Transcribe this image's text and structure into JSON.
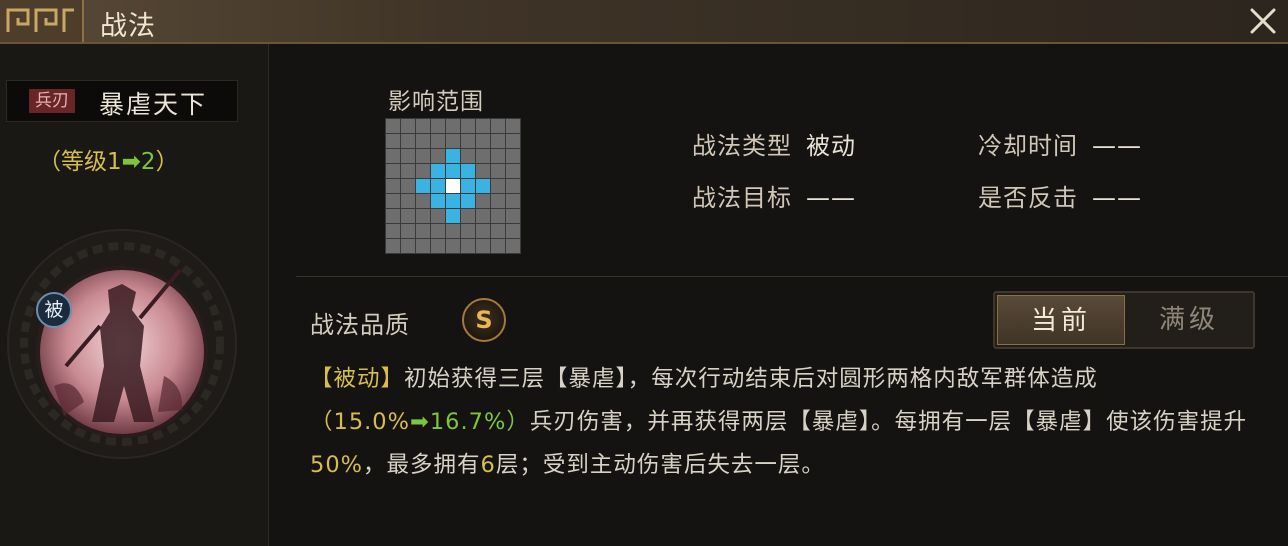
{
  "header": {
    "title": "战法"
  },
  "skill": {
    "weapon_tag": "兵刃",
    "name": "暴虐天下",
    "level_open": "（等级1",
    "level_arrow": "➡",
    "level_to": "2",
    "level_close": "）",
    "passive_badge": "被"
  },
  "range": {
    "label": "影响范围"
  },
  "info": {
    "type_label": "战法类型",
    "type_value": "被动",
    "cooldown_label": "冷却时间",
    "cooldown_value": "——",
    "target_label": "战法目标",
    "target_value": "——",
    "counter_label": "是否反击",
    "counter_value": "——"
  },
  "quality": {
    "label": "战法品质",
    "grade": "S"
  },
  "toggle": {
    "current": "当前",
    "max": "满级"
  },
  "description": {
    "p1": "【被动】",
    "p2": "初始获得三层【暴虐】，每次行动结束后对圆形两格内敌军群体造成",
    "p3": "（15.0%",
    "p4": "➡",
    "p5": "16.7%）",
    "p6": "兵刃伤害，并再获得两层【暴虐】。每拥有一层【暴虐】使该伤害提升",
    "p7": "50%",
    "p8": "，最多拥有",
    "p9": "6",
    "p10": "层；受到主动伤害后失去一层。"
  },
  "colors": {
    "highlight_yellow": "#d6bd4c",
    "highlight_green": "#7dc63b",
    "grid_cell": "#6e6e6e",
    "grid_range": "#3bb3e2",
    "grid_center": "#ffffff"
  }
}
